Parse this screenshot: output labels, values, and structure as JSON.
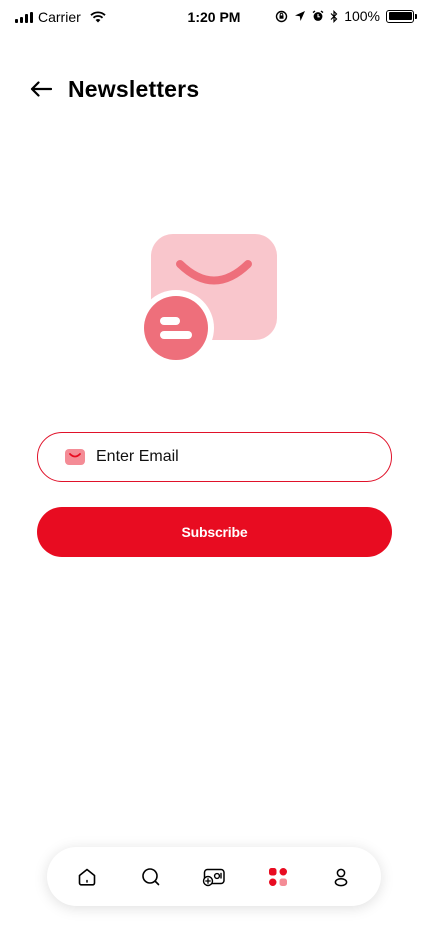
{
  "status_bar": {
    "carrier": "Carrier",
    "time": "1:20 PM",
    "battery": "100%",
    "icons": [
      "signal-icon",
      "wifi-icon",
      "rotation-lock-icon",
      "location-icon",
      "alarm-icon",
      "bluetooth-icon",
      "battery-icon"
    ]
  },
  "header": {
    "title": "Newsletters",
    "back_icon": "arrow-left-icon"
  },
  "illustration": {
    "icon": "newsletter-envelope-icon",
    "colors": {
      "envelope": "#f9c6cc",
      "badge": "#ee6f7b",
      "flap": "#ee6f7b"
    }
  },
  "email_field": {
    "placeholder": "Enter Email",
    "value": "",
    "icon": "mail-icon"
  },
  "subscribe_button": {
    "label": "Subscribe"
  },
  "bottom_nav": {
    "items": [
      {
        "icon": "home-icon",
        "active": false
      },
      {
        "icon": "search-icon",
        "active": false
      },
      {
        "icon": "gallery-add-icon",
        "active": false
      },
      {
        "icon": "categories-icon",
        "active": true
      },
      {
        "icon": "profile-icon",
        "active": false
      }
    ]
  },
  "colors": {
    "accent": "#e80c21",
    "accent_light": "#f48c96",
    "text": "#000000",
    "background": "#ffffff"
  }
}
